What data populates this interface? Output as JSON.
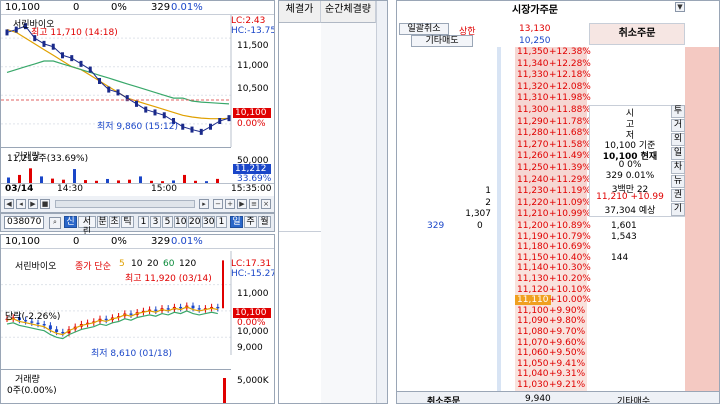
{
  "left_top": {
    "price": "10,100",
    "change": "0",
    "change_pct": "0%",
    "volume": "329",
    "vol_pct": "0.01%",
    "name": "서린바이오",
    "lc": "LC:2.43",
    "hc": "HC:-13.75",
    "high_label": "최고 11,710 (14:18)",
    "low_label": "최저 9,860 (15:12)",
    "y_ticks": [
      "11,500",
      "11,000",
      "10,500",
      "10,000"
    ],
    "cur_price_tag": "10,100",
    "cur_pct_tag": "0.00%",
    "vol_title": "거래량",
    "vol_value": "11,212주(33.69%)",
    "vol_ticks": [
      "50,000"
    ],
    "vol_tag": "11,212",
    "vol_tag_pct": "33.69%",
    "x_ticks": [
      "03/14",
      "14:30",
      "15:00",
      "15:35:00"
    ],
    "chart_data": {
      "type": "line",
      "title": "",
      "series": [
        {
          "name": "price",
          "values": [
            11600,
            11650,
            11710,
            11500,
            11400,
            11350,
            11200,
            11150,
            11050,
            10950,
            10750,
            10600,
            10550,
            10450,
            10350,
            10250,
            10200,
            10150,
            10050,
            9950,
            9900,
            9860,
            9950,
            10050,
            10100
          ]
        },
        {
          "name": "",
          "values": [
            11650,
            11600,
            11500,
            11400,
            11300,
            11200,
            11100,
            11000,
            10950,
            10850,
            10750,
            10650,
            10550,
            10450,
            10400,
            10350,
            10300,
            10250,
            10200,
            10150,
            10120,
            10100,
            10090,
            10090,
            10095
          ]
        },
        {
          "name": "",
          "values": [
            10900,
            10950,
            11000,
            11050,
            11100,
            11100,
            11050,
            11000,
            10950,
            10900,
            10850,
            10800,
            10750,
            10700,
            10650,
            10600,
            10550,
            10500,
            10450,
            10450,
            10400,
            10380,
            10370,
            10360,
            10350
          ]
        }
      ],
      "volumes": [
        15000,
        22000,
        40000,
        18000,
        12000,
        9000,
        38000,
        8000,
        6000,
        11000,
        7000,
        9000,
        18000,
        6000,
        5000,
        7000,
        22000,
        6000,
        5000,
        11212
      ],
      "ylim": [
        9700,
        11800
      ],
      "vol_ylim": [
        0,
        60000
      ]
    }
  },
  "toolbar": {
    "code": "038070",
    "items": [
      "신",
      "서린",
      "분",
      "초",
      "틱",
      "1",
      "3",
      "5",
      "10",
      "20",
      "30",
      "1",
      "일",
      "주",
      "월"
    ]
  },
  "left_bottom": {
    "price": "10,100",
    "change": "0",
    "change_pct": "0%",
    "volume": "329",
    "vol_pct": "0.01%",
    "name": "서린바이오",
    "ma_labels": [
      "종가 단순",
      "5",
      "10",
      "20",
      "60",
      "120"
    ],
    "lc": "LC:17.31",
    "hc": "HC:-15.27",
    "high_label": "최고 11,920 (03/14)",
    "low_label": "최저 8,610 (01/18)",
    "chg_label": "당락(-2.26%)",
    "y_ticks": [
      "11,000",
      "10,000",
      "9,000"
    ],
    "cur_price_tag": "10,100",
    "cur_pct_tag": "0.00%",
    "vol_title": "거래량",
    "vol_value": "0주(0.00%)",
    "vol_ticks": [
      "5,000K"
    ]
  },
  "middle": {
    "col1": "체결가",
    "col2": "순간체결량"
  },
  "orderbook": {
    "top_label": "시장가주문",
    "left_btn1": "일괄취소",
    "left_btn2": "상한",
    "upper_limit": "13,130",
    "left_btn3": "기타매도",
    "prev_close_ref": "10,250",
    "cancel_label": "취소주문",
    "asks": [
      {
        "p": "11,350",
        "pct": "+12.38%"
      },
      {
        "p": "11,340",
        "pct": "+12.28%"
      },
      {
        "p": "11,330",
        "pct": "+12.18%"
      },
      {
        "p": "11,320",
        "pct": "+12.08%"
      },
      {
        "p": "11,310",
        "pct": "+11.98%"
      },
      {
        "p": "11,300",
        "pct": "+11.88%"
      },
      {
        "p": "11,290",
        "pct": "+11.78%"
      },
      {
        "p": "11,280",
        "pct": "+11.68%"
      },
      {
        "p": "11,270",
        "pct": "+11.58%"
      },
      {
        "p": "11,260",
        "pct": "+11.49%"
      },
      {
        "p": "11,250",
        "pct": "+11.39%"
      },
      {
        "p": "11,240",
        "pct": "+11.29%"
      },
      {
        "p": "11,230",
        "pct": "+11.19%",
        "q": "1"
      },
      {
        "p": "11,220",
        "pct": "+11.09%",
        "q": "2"
      },
      {
        "p": "11,210",
        "pct": "+10.99%",
        "q": "1,307"
      }
    ],
    "bids": [
      {
        "p": "11,200",
        "pct": "+10.89%",
        "q": "1,601"
      },
      {
        "p": "11,190",
        "pct": "+10.79%",
        "q": "1,543"
      },
      {
        "p": "11,180",
        "pct": "+10.69%",
        "q": ""
      },
      {
        "p": "11,150",
        "pct": "+10.40%",
        "q": "144"
      },
      {
        "p": "11,140",
        "pct": "+10.30%"
      },
      {
        "p": "11,130",
        "pct": "+10.20%"
      },
      {
        "p": "11,120",
        "pct": "+10.10%"
      },
      {
        "p": "11,110",
        "pct": "+10.00%"
      },
      {
        "p": "11,100",
        "pct": "+9.90%"
      },
      {
        "p": "11,090",
        "pct": "+9.80%"
      },
      {
        "p": "11,080",
        "pct": "+9.70%"
      },
      {
        "p": "11,070",
        "pct": "+9.60%"
      },
      {
        "p": "11,060",
        "pct": "+9.50%"
      },
      {
        "p": "11,050",
        "pct": "+9.41%"
      },
      {
        "p": "11,040",
        "pct": "+9.31%"
      },
      {
        "p": "11,030",
        "pct": "+9.21%"
      }
    ],
    "left_vals": [
      "329",
      "0"
    ],
    "info_lines": [
      "시",
      "고",
      "저",
      "10,100 기준",
      "10,100 현재",
      "0 0%",
      "329 0.01%",
      "3백만 22",
      "11,210 +10.99",
      "37,304 예상"
    ],
    "side_tabs": [
      "투",
      "거",
      "외",
      "일",
      "차",
      "뉴",
      "권",
      "기"
    ],
    "bottom_left": "취소주문",
    "bottom_val": "9,940",
    "bottom_right": "기타매수"
  },
  "colors": {
    "price_line": "#1a2a8a",
    "ma5": "#e0a000",
    "ma20": "#39a86a",
    "vol_bar": "#e00000",
    "ask_bg": "#f6d7d3",
    "bid_bg": "#f9e2dd",
    "highlight": "#f0a020"
  }
}
